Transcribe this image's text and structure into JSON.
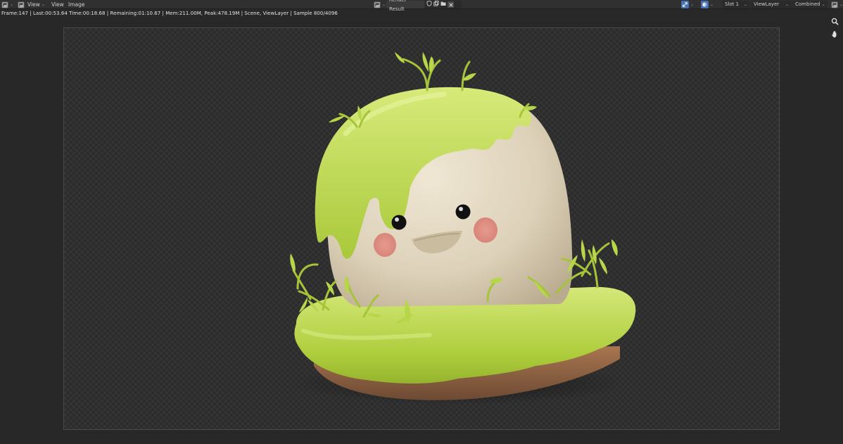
{
  "header": {
    "view_menu_label": "View",
    "view_menu2_label": "View",
    "image_menu_label": "Image",
    "image_name": "Render Result",
    "slot": "Slot 1",
    "view_layer": "ViewLayer",
    "render_pass": "Combined"
  },
  "info": {
    "status_line": "Frame:147 | Last:00:53.64 Time:00:18.68 | Remaining:01:10.67 | Mem:211.00M, Peak:478.19M | Scene, ViewLayer | Sample 800/4096"
  },
  "icons": {
    "editor_type": "image-editor-icon",
    "view_mode": "view-mode-icon",
    "browse": "image-browse-icon",
    "fake_user": "shield-icon",
    "new_image": "duplicate-icon",
    "open": "folder-icon",
    "unlink": "close-icon",
    "gizmo": "gizmo-icon",
    "display_channels": "display-channels-icon",
    "zoom": "zoom-icon",
    "pan": "hand-icon"
  },
  "colors": {
    "header_bg": "#303030",
    "editor_bg": "#282828",
    "accent_blue": "#4772b3",
    "moss_green": "#b6d33f",
    "stone": "#e6dcc8",
    "soil": "#9a6a4a"
  }
}
